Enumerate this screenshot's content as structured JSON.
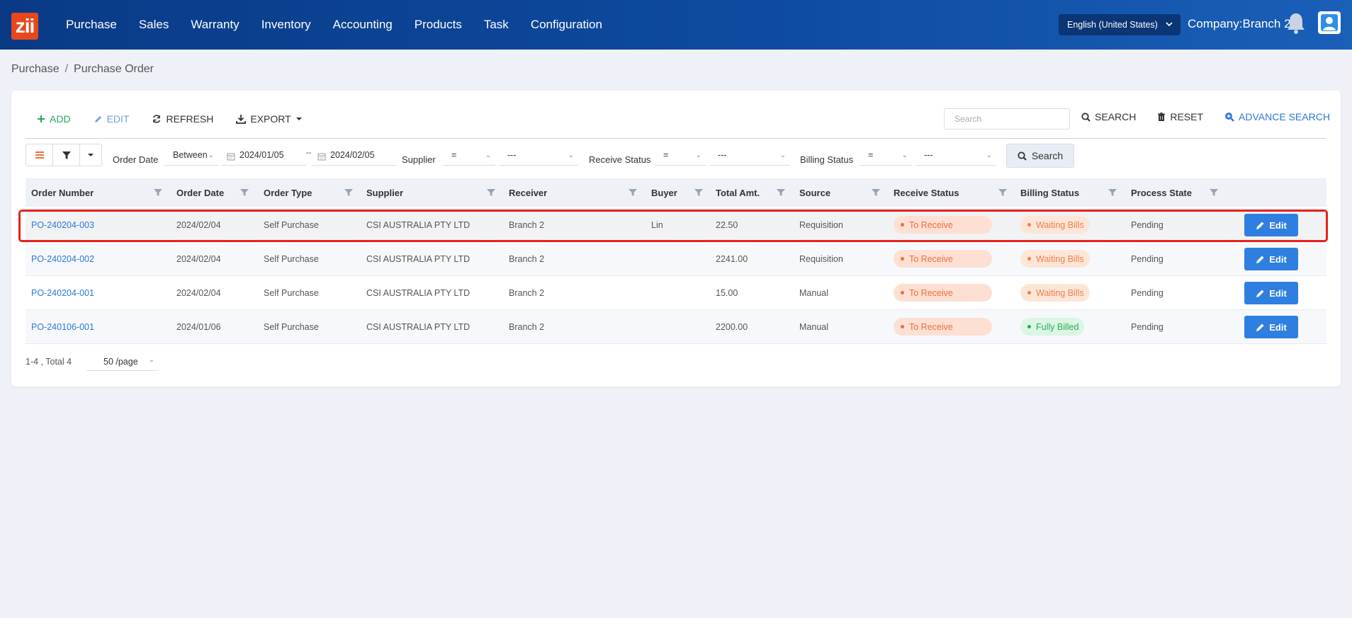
{
  "app": {
    "logo_text": "zii"
  },
  "nav": [
    "Purchase",
    "Sales",
    "Warranty",
    "Inventory",
    "Accounting",
    "Products",
    "Task",
    "Configuration"
  ],
  "header": {
    "language": "English (United States)",
    "company": "Company:Branch 2"
  },
  "breadcrumb": {
    "root": "Purchase",
    "sep": "/",
    "current": "Purchase Order"
  },
  "toolbar": {
    "add": "ADD",
    "edit": "EDIT",
    "refresh": "REFRESH",
    "export": "EXPORT"
  },
  "search": {
    "placeholder": "Search",
    "search_label": "SEARCH",
    "reset_label": "RESET",
    "advance_label": "ADVANCE SEARCH"
  },
  "filters": {
    "order_date_label": "Order Date",
    "order_date_op": "Between",
    "date_from": "2024/01/05",
    "date_sep": "--",
    "date_to": "2024/02/05",
    "supplier_label": "Supplier",
    "supplier_op": "=",
    "supplier_value": "---",
    "receive_status_label": "Receive Status",
    "receive_status_op": "=",
    "receive_status_value": "---",
    "billing_status_label": "Billing Status",
    "billing_status_op": "=",
    "billing_status_value": "---",
    "search_button": "Search"
  },
  "table": {
    "columns": [
      "Order Number",
      "Order Date",
      "Order Type",
      "Supplier",
      "Receiver",
      "Buyer",
      "Total Amt.",
      "Source",
      "Receive Status",
      "Billing Status",
      "Process State"
    ],
    "edit_label": "Edit",
    "rows": [
      {
        "order_number": "PO-240204-003",
        "order_date": "2024/02/04",
        "order_type": "Self Purchase",
        "supplier": "CSI AUSTRALIA PTY LTD",
        "receiver": "Branch 2",
        "buyer": "Lin",
        "total": "22.50",
        "source": "Requisition",
        "receive_status": "To Receive",
        "billing_status": "Waiting Bills",
        "process_state": "Pending"
      },
      {
        "order_number": "PO-240204-002",
        "order_date": "2024/02/04",
        "order_type": "Self Purchase",
        "supplier": "CSI AUSTRALIA PTY LTD",
        "receiver": "Branch 2",
        "buyer": "",
        "total": "2241.00",
        "source": "Requisition",
        "receive_status": "To Receive",
        "billing_status": "Waiting Bills",
        "process_state": "Pending"
      },
      {
        "order_number": "PO-240204-001",
        "order_date": "2024/02/04",
        "order_type": "Self Purchase",
        "supplier": "CSI AUSTRALIA PTY LTD",
        "receiver": "Branch 2",
        "buyer": "",
        "total": "15.00",
        "source": "Manual",
        "receive_status": "To Receive",
        "billing_status": "Waiting Bills",
        "process_state": "Pending"
      },
      {
        "order_number": "PO-240106-001",
        "order_date": "2024/01/06",
        "order_type": "Self Purchase",
        "supplier": "CSI AUSTRALIA PTY LTD",
        "receiver": "Branch 2",
        "buyer": "",
        "total": "2200.00",
        "source": "Manual",
        "receive_status": "To Receive",
        "billing_status": "Fully Billed",
        "process_state": "Pending"
      }
    ]
  },
  "pagination": {
    "summary": "1-4 , Total 4",
    "page_size": "50 /page"
  },
  "colors": {
    "brand": "#0d4a9f",
    "accent": "#2f7fe0",
    "highlight": "#e8211b",
    "logo": "#e8471e"
  }
}
